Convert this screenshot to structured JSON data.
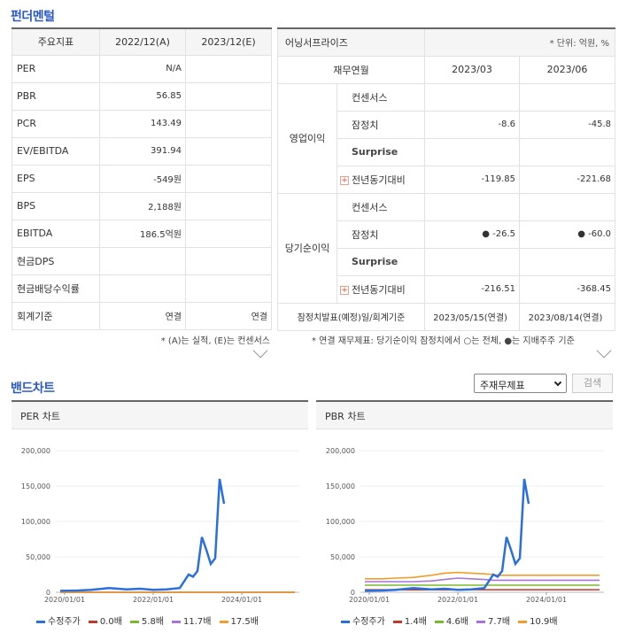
{
  "fundamental": {
    "title": "펀더멘털",
    "header": [
      "주요지표",
      "2022/12(A)",
      "2023/12(E)"
    ],
    "rows": [
      {
        "label": "PER",
        "a": "N/A",
        "e": ""
      },
      {
        "label": "PBR",
        "a": "56.85",
        "e": ""
      },
      {
        "label": "PCR",
        "a": "143.49",
        "e": ""
      },
      {
        "label": "EV/EBITDA",
        "a": "391.94",
        "e": ""
      },
      {
        "label": "EPS",
        "a": "-549원",
        "e": ""
      },
      {
        "label": "BPS",
        "a": "2,188원",
        "e": ""
      },
      {
        "label": "EBITDA",
        "a": "186.5억원",
        "e": ""
      },
      {
        "label": "현금DPS",
        "a": "",
        "e": ""
      },
      {
        "label": "현금배당수익률",
        "a": "",
        "e": ""
      },
      {
        "label": "회계기준",
        "a": "연결",
        "e": "연결"
      }
    ],
    "note": "* (A)는 실적, (E)는 컨센서스"
  },
  "earnings": {
    "title": "어닝서프라이즈",
    "unit": "* 단위: 억원, %",
    "header": [
      "재무연월",
      "2023/03",
      "2023/06"
    ],
    "groups": [
      {
        "name": "영업이익",
        "rows": [
          {
            "label": "컨센서스",
            "v1": "",
            "v2": ""
          },
          {
            "label": "잠정치",
            "v1": "-8.6",
            "v2": "-45.8"
          },
          {
            "label": "Surprise",
            "v1": "",
            "v2": ""
          },
          {
            "label": "전년동기대비",
            "v1": "-119.85",
            "v2": "-221.68"
          }
        ]
      },
      {
        "name": "당기순이익",
        "rows": [
          {
            "label": "컨센서스",
            "v1": "",
            "v2": ""
          },
          {
            "label": "잠정치",
            "v1": "● -26.5",
            "v2": "● -60.0"
          },
          {
            "label": "Surprise",
            "v1": "",
            "v2": ""
          },
          {
            "label": "전년동기대비",
            "v1": "-216.51",
            "v2": "-368.45"
          }
        ]
      }
    ],
    "footer": {
      "label": "잠정치발표(예정)일/회계기준",
      "v1": "2023/05/15(연결)",
      "v2": "2023/08/14(연결)"
    },
    "note": "* 연결 재무제표: 당기순이익 잠정치에서 ○는 전체, ●는 지배주주 기준"
  },
  "band": {
    "title": "밴드차트",
    "select_value": "주재무제표",
    "search_label": "검색"
  },
  "chart_data": [
    {
      "type": "line",
      "title": "PER 차트",
      "yticks": [
        "200,000",
        "150,000",
        "100,000",
        "50,000",
        "0"
      ],
      "xticks": [
        "2020/01/01",
        "2022/01/01",
        "2024/01/01"
      ],
      "ylim": [
        0,
        200000
      ],
      "x": [
        2019.9,
        2020.3,
        2020.6,
        2021.0,
        2021.4,
        2021.7,
        2022.0,
        2022.3,
        2022.6,
        2022.8,
        2022.9,
        2023.0,
        2023.1,
        2023.2,
        2023.3,
        2023.4,
        2023.5,
        2023.6
      ],
      "series": [
        {
          "name": "수정주가",
          "color": "#2a6fdc",
          "values": [
            2000,
            2500,
            3500,
            6000,
            4000,
            5000,
            3500,
            4000,
            6000,
            25000,
            22000,
            30000,
            78000,
            60000,
            40000,
            48000,
            160000,
            125000
          ]
        },
        {
          "name": "0.0배",
          "color": "#c0392b",
          "values": [
            0,
            0
          ]
        },
        {
          "name": "5.8배",
          "color": "#7cb82f",
          "values": [
            0,
            0
          ]
        },
        {
          "name": "11.7배",
          "color": "#a874d8",
          "values": [
            0,
            0
          ]
        },
        {
          "name": "17.5배",
          "color": "#f39c2a",
          "values": [
            0,
            0
          ]
        }
      ]
    },
    {
      "type": "line",
      "title": "PBR 차트",
      "yticks": [
        "200,000",
        "150,000",
        "100,000",
        "50,000",
        "0"
      ],
      "xticks": [
        "2020/01/01",
        "2022/01/01",
        "2024/01/01"
      ],
      "ylim": [
        0,
        200000
      ],
      "x": [
        2019.9,
        2020.3,
        2020.6,
        2021.0,
        2021.4,
        2021.7,
        2022.0,
        2022.3,
        2022.6,
        2022.8,
        2022.9,
        2023.0,
        2023.1,
        2023.2,
        2023.3,
        2023.4,
        2023.5,
        2023.6
      ],
      "series": [
        {
          "name": "수정주가",
          "color": "#2a6fdc",
          "values": [
            2000,
            2500,
            3500,
            6000,
            4000,
            5000,
            3500,
            4000,
            6000,
            25000,
            22000,
            30000,
            78000,
            60000,
            40000,
            48000,
            160000,
            125000
          ]
        },
        {
          "name": "1.4배",
          "color": "#c0392b",
          "values": [
            3500,
            3500,
            3500,
            3500,
            3500,
            3500,
            3600,
            3600,
            3600,
            3600,
            3600,
            3600,
            3600,
            3600,
            3600,
            3600,
            3600,
            3600
          ]
        },
        {
          "name": "4.6배",
          "color": "#7cb82f",
          "values": [
            10000,
            10000,
            10000,
            10000,
            10000,
            10000,
            10000,
            10000,
            10000,
            10000,
            10000,
            10000,
            10000,
            10000,
            10000,
            10000,
            10000,
            10000
          ]
        },
        {
          "name": "7.7배",
          "color": "#a874d8",
          "values": [
            15000,
            15000,
            15000,
            15000,
            16000,
            18000,
            20000,
            19000,
            18000,
            17000,
            17000,
            17000,
            17000,
            17000,
            17000,
            17000,
            17000,
            17000
          ]
        },
        {
          "name": "10.9배",
          "color": "#f39c2a",
          "values": [
            19000,
            19000,
            20000,
            21000,
            24000,
            27000,
            28000,
            27000,
            26000,
            25000,
            24000,
            24000,
            24000,
            24000,
            24000,
            24000,
            24000,
            24000
          ]
        }
      ]
    }
  ]
}
